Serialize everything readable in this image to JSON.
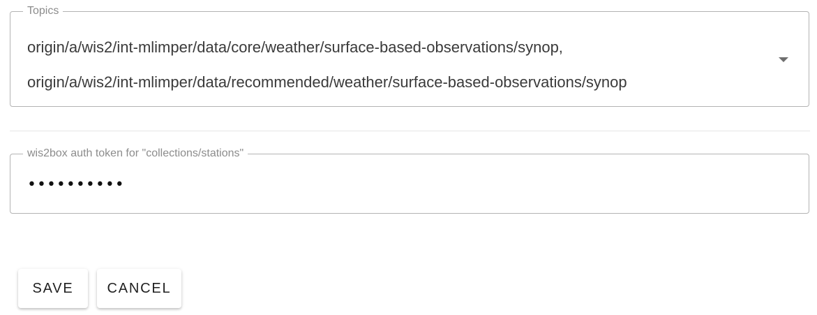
{
  "topics": {
    "label": "Topics",
    "values": [
      "origin/a/wis2/int-mlimper/data/core/weather/surface-based-observations/synop,",
      "origin/a/wis2/int-mlimper/data/recommended/weather/surface-based-observations/synop"
    ],
    "icon": "caret-down-icon"
  },
  "token": {
    "label": "wis2box auth token for \"collections/stations\"",
    "value": "••••••••••"
  },
  "actions": {
    "save_label": "SAVE",
    "cancel_label": "CANCEL"
  }
}
